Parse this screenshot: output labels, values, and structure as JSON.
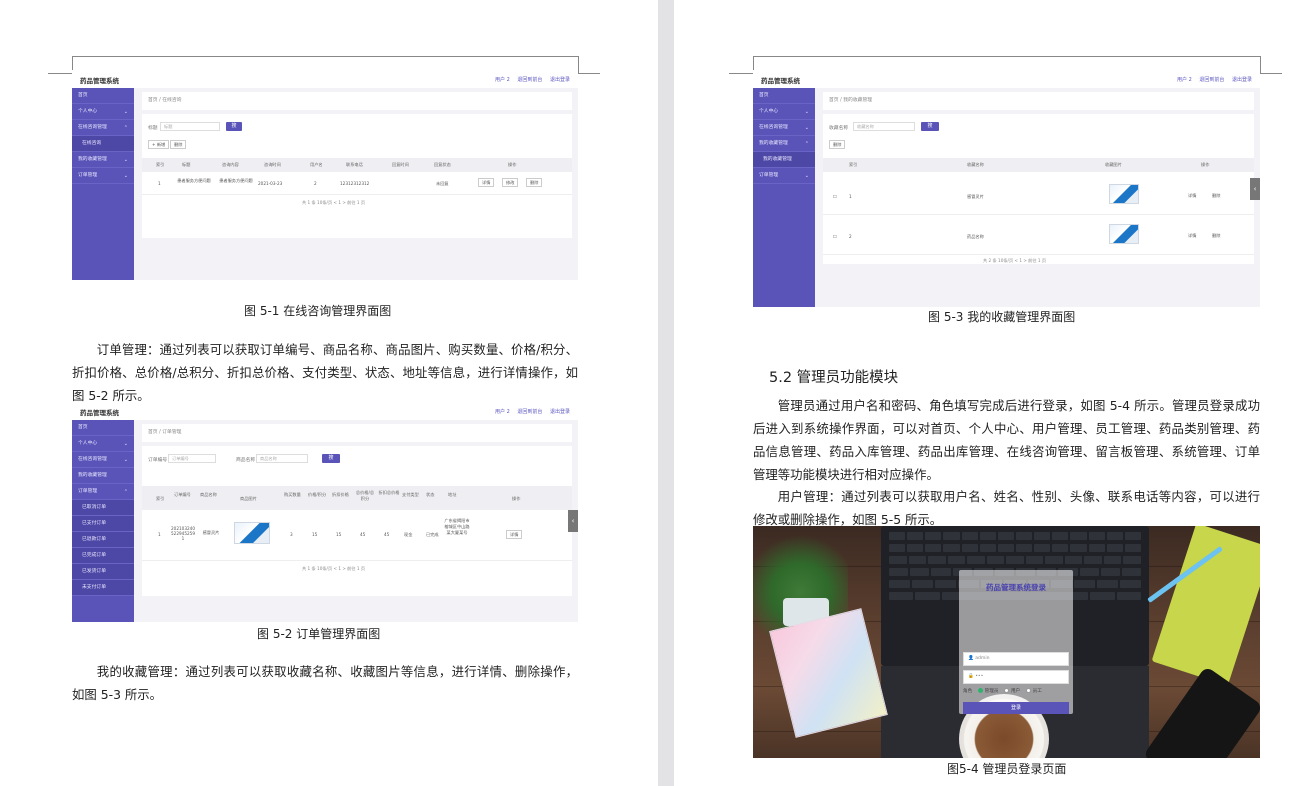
{
  "app": {
    "title": "药品管理系统",
    "top_links": [
      "用户 2",
      "退回到前台",
      "退出登录"
    ],
    "side_home": "首页",
    "side_personal": "个人中心",
    "side_consult": "在线咨询管理",
    "side_consult_sub": "在线咨询",
    "side_favorite": "我的收藏管理",
    "side_favorite_sub": "我的收藏管理",
    "side_order": "订单管理",
    "order_subs": [
      "已取消订单",
      "已支付订单",
      "已退款订单",
      "已完成订单",
      "已发货订单",
      "未支付订单"
    ]
  },
  "fig1": {
    "breadcrumb": "首页 / 在线咨询",
    "search_label": "标题",
    "search_placeholder": "标题",
    "search_button": "搜",
    "add_button": "+ 新增",
    "delete_button": "删除",
    "headers": [
      "索引",
      "标题",
      "咨询内容",
      "咨询时间",
      "用户名",
      "联系电话",
      "回复时间",
      "回复状态",
      "操作"
    ],
    "row": {
      "index": "1",
      "title": "患者服务方便问题",
      "content": "患者服务方便问题",
      "time": "2021-03-23",
      "user": "2",
      "phone": "12312312312",
      "reply_time": "",
      "status": "未回复"
    },
    "row_actions": [
      "详情",
      "修改",
      "删除"
    ],
    "pager": "共 1 条   10条/页   <  1  >   前往  1  页",
    "caption": "图 5-1 在线咨询管理界面图"
  },
  "para_order": "订单管理：通过列表可以获取订单编号、商品名称、商品图片、购买数量、价格/积分、折扣价格、总价格/总积分、折扣总价格、支付类型、状态、地址等信息，进行详情操作，如图 5-2 所示。",
  "fig2": {
    "breadcrumb": "首页 / 订单管理",
    "label1": "订单编号",
    "placeholder1": "订单编号",
    "label2": "商品名称",
    "placeholder2": "商品名称",
    "search_button": "搜",
    "headers": [
      "索引",
      "订单编号",
      "商品名称",
      "商品图片",
      "购买数量",
      "价格/积分",
      "折扣价格",
      "总价格/总积分",
      "折扣总价格",
      "支付类型",
      "状态",
      "地址",
      "操作"
    ],
    "row": {
      "index": "1",
      "order_no": "2021032405229452591",
      "name": "感冒灵片",
      "qty": "3",
      "price": "15",
      "discount": "15",
      "total": "45",
      "discount_total": "45",
      "pay": "现金",
      "status": "已完成",
      "address": "广东省揭阳市榕城区中山路某大厦某号"
    },
    "row_action": "详情",
    "pager": "共 1 条   10条/页   <  1  >   前往  1  页",
    "caption": "图 5-2 订单管理界面图"
  },
  "para_favorite": "我的收藏管理：通过列表可以获取收藏名称、收藏图片等信息，进行详情、删除操作，如图 5-3 所示。",
  "fig3": {
    "breadcrumb": "首页 / 我的收藏管理",
    "search_label": "收藏名称",
    "search_placeholder": "收藏名称",
    "search_button": "搜",
    "delete_button": "删除",
    "headers": [
      "索引",
      "收藏名称",
      "收藏图片",
      "操作"
    ],
    "rows": [
      {
        "index": "1",
        "name": "感冒灵片"
      },
      {
        "index": "2",
        "name": "药品名称"
      }
    ],
    "row_actions": [
      "详情",
      "删除"
    ],
    "pager": "共 2 条   10条/页   <  1  >   前往  1  页",
    "caption": "图 5-3 我的收藏管理界面图"
  },
  "section_heading": "5.2 管理员功能模块",
  "para_admin": "管理员通过用户名和密码、角色填写完成后进行登录，如图 5-4 所示。管理员登录成功后进入到系统操作界面，可以对首页、个人中心、用户管理、员工管理、药品类别管理、药品信息管理、药品入库管理、药品出库管理、在线咨询管理、留言板管理、系统管理、订单管理等功能模块进行相对应操作。",
  "para_user": "用户管理：通过列表可以获取用户名、姓名、性别、头像、联系电话等内容，可以进行修改或删除操作，如图 5-5 所示。",
  "fig4": {
    "login_title": "药品管理系统登录",
    "username": "admin",
    "password": "•••",
    "role_label": "角色",
    "roles": [
      "管理员",
      "用户",
      "员工"
    ],
    "login_button": "登录",
    "caption": "图5-4 管理员登录页面"
  }
}
